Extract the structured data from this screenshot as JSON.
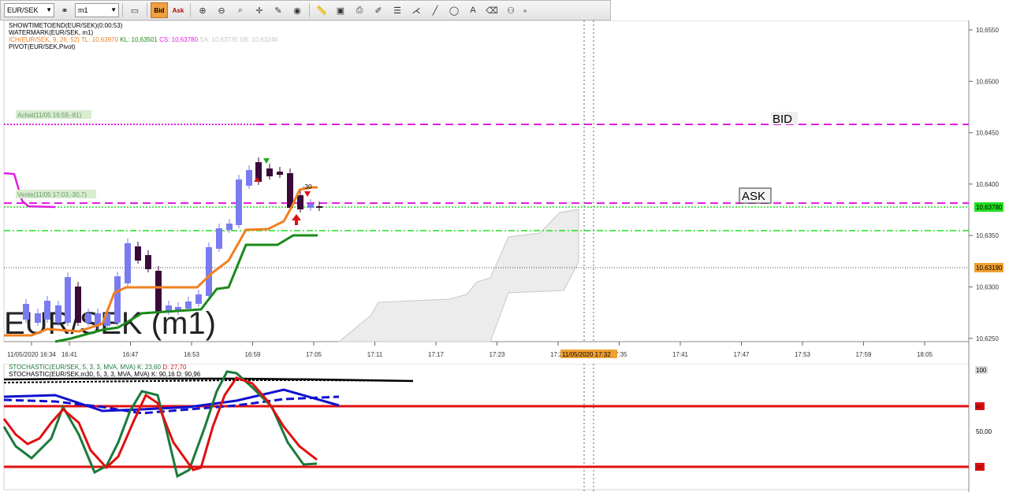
{
  "toolbar": {
    "symbol": "EUR/SEK",
    "timeframe": "m1",
    "bid_label": "Bid",
    "ask_label": "Ask"
  },
  "indicators": {
    "line1": "SHOWTIMETOEND(EUR/SEK)(0:00:53)",
    "line2": "WATERMARK(EUR/SEK, m1)",
    "ich_name": "ICH(EUR/SEK, 9, 26, 52)",
    "ich_tl": "TL: 10,63970",
    "ich_kl": "KL: 10,63501",
    "ich_cs": "CS: 10,63780",
    "ich_sa": "SA: 10,63735",
    "ich_sb": "SB: 10,63246",
    "line4": "PIVOT(EUR/SEK,Pivot)"
  },
  "labels": {
    "achat": "Achat(11/05 16:59,-81)",
    "vente": "Vente(11/05 17:03,-30,7)",
    "bid": "BID",
    "ask": "ASK",
    "watermark": "EUR/SEK (m1)",
    "trade_value": "-30",
    "crosshair_time": "11/05/2020 17:32"
  },
  "price_axis": {
    "ticks": [
      "10,6550",
      "10,6500",
      "10,6450",
      "10,6400",
      "10,6350",
      "10,6300",
      "10,6250"
    ],
    "current_price": "10,63780",
    "cursor_price": "10,63190"
  },
  "time_axis": {
    "ticks": [
      "11/05/2020 16:34",
      "16:41",
      "16:47",
      "16:53",
      "16:59",
      "17:05",
      "17:11",
      "17:17",
      "17:23",
      "17:29",
      "17:35",
      "17:41",
      "17:47",
      "17:53",
      "17:59",
      "18:05"
    ]
  },
  "stochastic": {
    "line1_name": "STOCHASTIC(EUR/SEK, 5, 3, 3, MVA, MVA)",
    "line1_k": "K: 23,60",
    "line1_d": "D: 27,70",
    "line2_name": "STOCHASTIC(EUR/SEK.m30, 5, 3, 3, MVA, MVA)",
    "line2_k": "K: 90,16",
    "line2_d": "D: 90,96",
    "axis_top": "100",
    "axis_mid": "50,00",
    "level_high": "80",
    "level_low": "20"
  },
  "colors": {
    "bull": "#7b7bf0",
    "bear": "#3a0a3a",
    "tenkan": "#f08020",
    "kijun": "#1a8a1a",
    "cloud": "#e8e8e8",
    "pivot": "#e020e0",
    "current_price": "#22dd22",
    "stoch_k": "#1a7a3a",
    "stoch_d": "#e01010",
    "stoch2_k": "#1010d0"
  }
}
